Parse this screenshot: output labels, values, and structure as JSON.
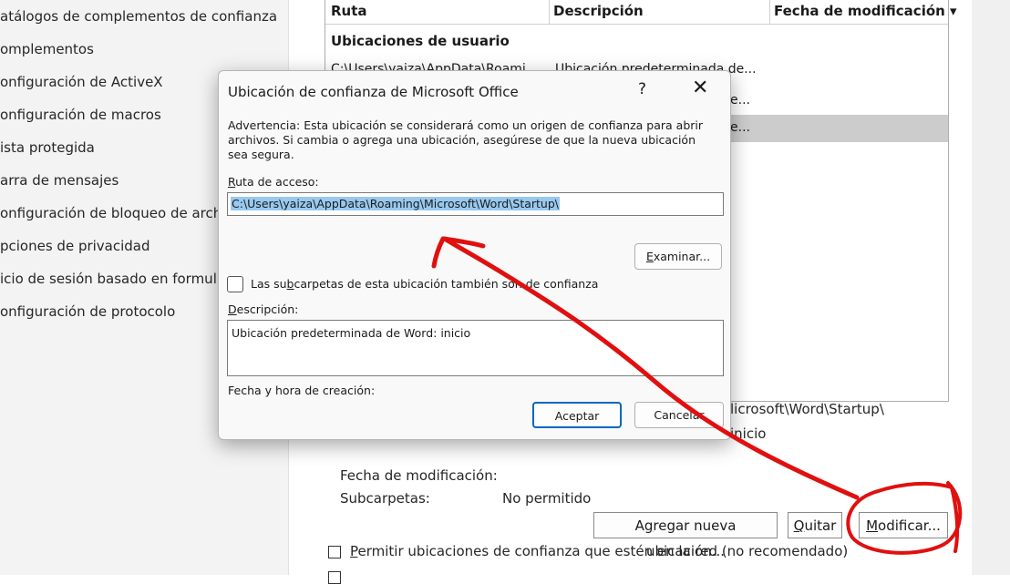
{
  "sidebar": {
    "items": [
      {
        "label": "atálogos de complementos de confianza"
      },
      {
        "label": "omplementos"
      },
      {
        "label": "onfiguración de ActiveX"
      },
      {
        "label": "onfiguración de macros"
      },
      {
        "label": "ista protegida"
      },
      {
        "label": "arra de mensajes"
      },
      {
        "label": "onfiguración de bloqueo de arch"
      },
      {
        "label": "pciones de privacidad"
      },
      {
        "label": "icio de sesión basado en formul"
      },
      {
        "label": "onfiguración de protocolo"
      }
    ]
  },
  "table": {
    "headers": {
      "ruta": "Ruta",
      "descripcion": "Descripción",
      "fecha": "Fecha de modificación ▾"
    },
    "group": "Ubicaciones de usuario",
    "rows": [
      {
        "ruta": "C:\\Users\\yaiza\\AppData\\Roami...",
        "descripcion": "Ubicación predeterminada de..."
      },
      {
        "ruta": "",
        "descripcion": "e..."
      },
      {
        "ruta": "",
        "descripcion": "e..."
      }
    ]
  },
  "details": {
    "path_tail": "licrosoft\\Word\\Startup\\",
    "desc_tail": "inicio",
    "fecha_label": "Fecha de modificación:",
    "subcarpetas_label": "Subcarpetas:",
    "subcarpetas_value": "No permitido"
  },
  "buttons": {
    "agregar_pre": "A",
    "agregar_u": "g",
    "agregar_post": "regar nueva ubicación...",
    "quitar_u": "Q",
    "quitar_post": "uitar",
    "modificar_u": "M",
    "modificar_post": "odificar..."
  },
  "network_checkbox": {
    "label_u": "P",
    "label_post": "ermitir ubicaciones de confianza que estén en la red (no recomendado)"
  },
  "dialog": {
    "title": "Ubicación de confianza de Microsoft Office",
    "help": "?",
    "close": "✕",
    "warning": "Advertencia: Esta ubicación se considerará como un origen de confianza para abrir archivos. Si cambia o agrega una ubicación, asegúrese de que la nueva ubicación sea segura.",
    "path_label_u": "R",
    "path_label_post": "uta de acceso:",
    "path_value": "C:\\Users\\yaiza\\AppData\\Roaming\\Microsoft\\Word\\Startup\\",
    "examinar_u": "E",
    "examinar_post": "xaminar...",
    "subfolders_pre": "Las su",
    "subfolders_u": "b",
    "subfolders_post": "carpetas de esta ubicación también son de confianza",
    "desc_label_u": "D",
    "desc_label_post": "escripción:",
    "desc_value": "Ubicación predeterminada de Word: inicio",
    "fecha_label": "Fecha y hora de creación:",
    "aceptar": "Aceptar",
    "cancelar": "Cancelar"
  },
  "colors": {
    "annotation": "#e01010",
    "accent": "#0067c0",
    "selection": "#99c9ef"
  }
}
